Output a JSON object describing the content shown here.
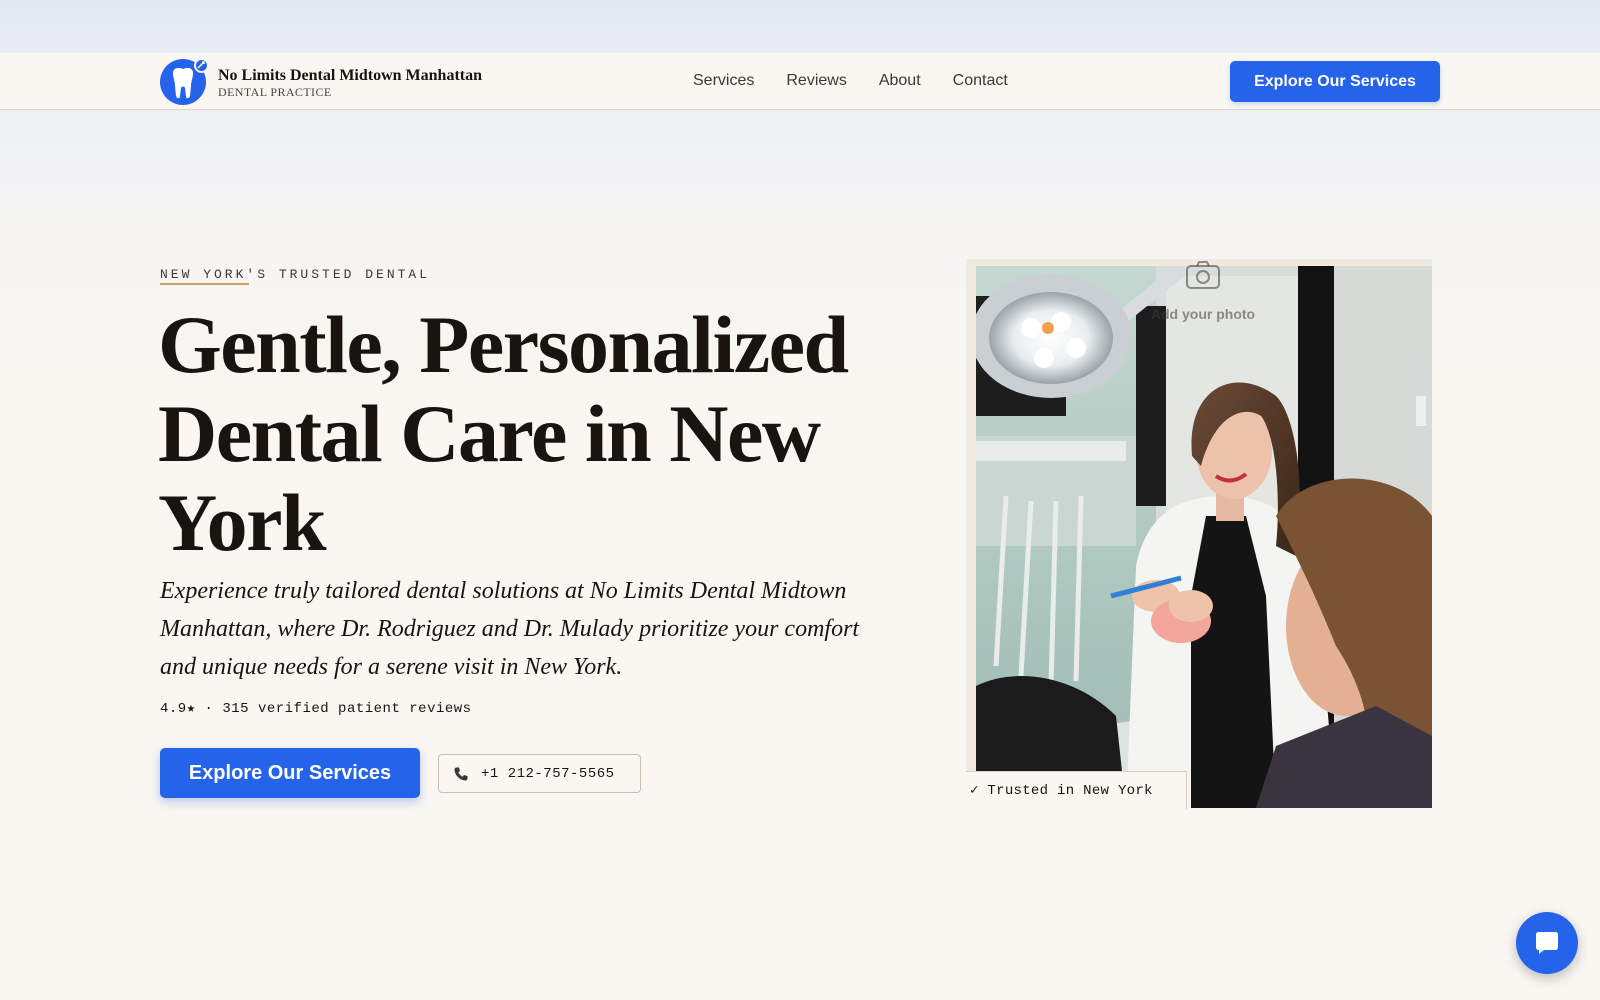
{
  "brand": {
    "name": "No Limits Dental Midtown Manhattan",
    "subtitle": "DENTAL PRACTICE"
  },
  "nav": {
    "links": [
      "Services",
      "Reviews",
      "About",
      "Contact"
    ],
    "cta_label": "Explore Our Services"
  },
  "hero": {
    "eyebrow": "NEW YORK'S TRUSTED DENTAL",
    "title": "Gentle, Personalized Dental Care in New York",
    "subtitle": "Experience truly tailored dental solutions at No Limits Dental Midtown Manhattan, where Dr. Rodriguez and Dr. Mulady prioritize your comfort and unique needs for a serene visit in New York.",
    "rating": "4.9★ · 315 verified patient reviews",
    "cta_label": "Explore Our Services",
    "phone": "+1 212-757-5565"
  },
  "photo": {
    "add_photo_label": "Add your photo",
    "badge": "✓ Trusted in New York"
  },
  "icons": {
    "logo": "tooth-icon",
    "phone": "phone-icon",
    "camera": "camera-icon",
    "chat": "chat-icon"
  },
  "colors": {
    "accent": "#2563eb",
    "background": "#faf7f2",
    "text": "#1a1410",
    "underline_gold": "#c9a35f"
  }
}
